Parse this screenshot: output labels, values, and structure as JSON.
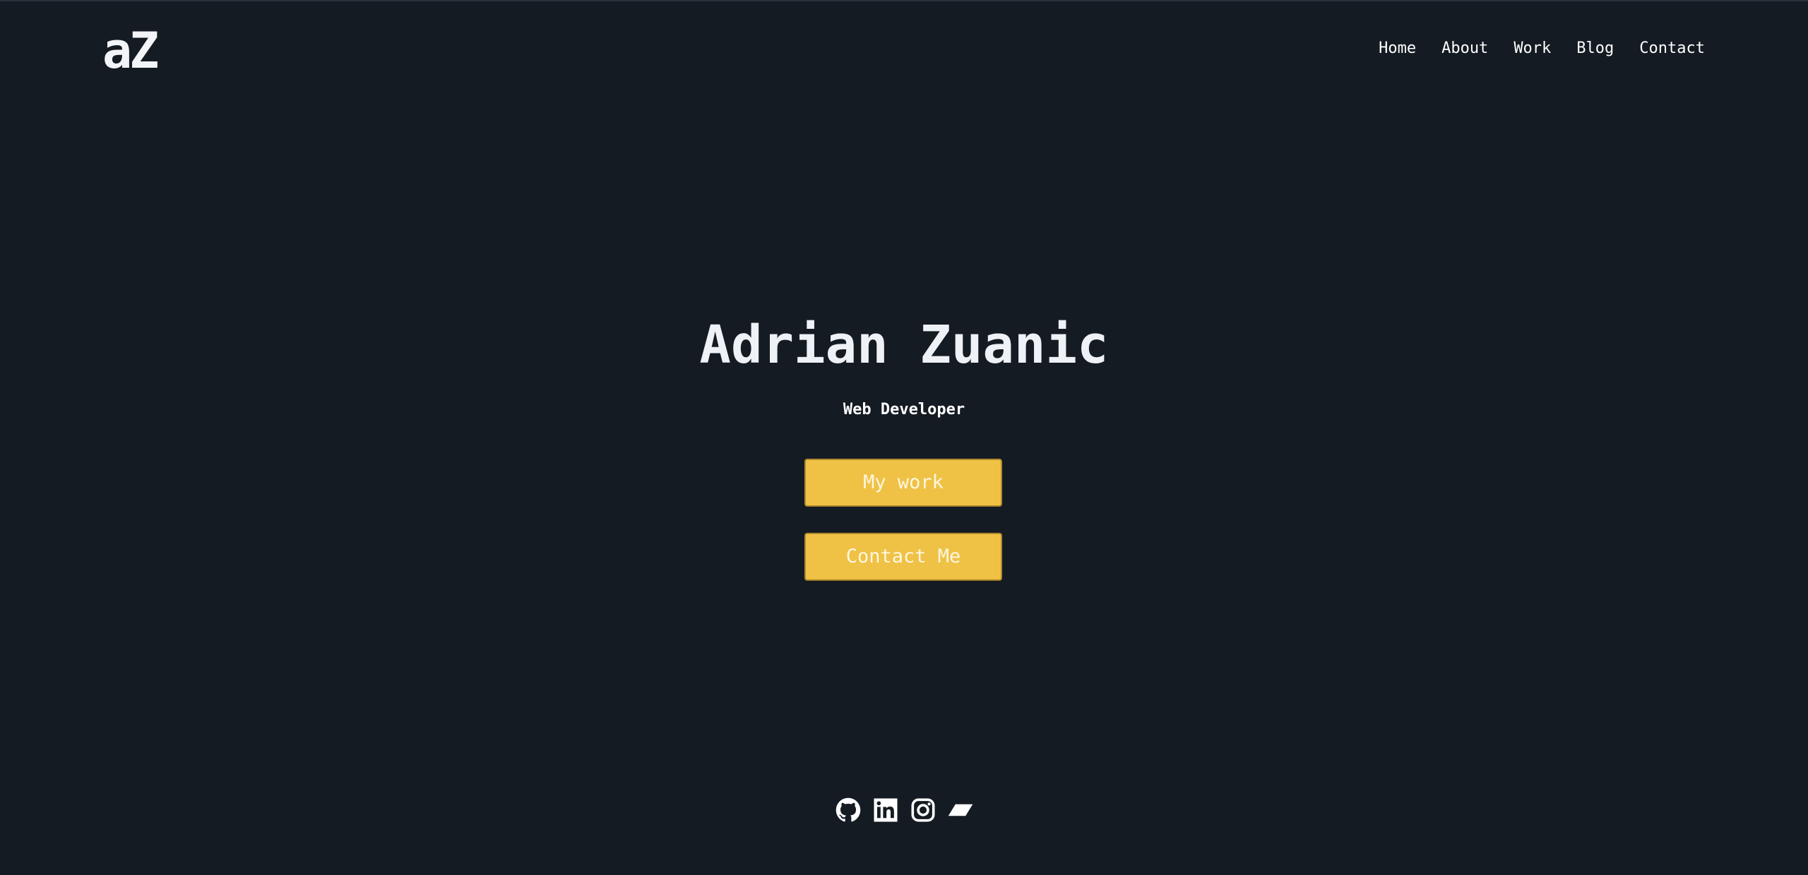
{
  "header": {
    "logo": "aZ",
    "nav": [
      {
        "label": "Home"
      },
      {
        "label": "About"
      },
      {
        "label": "Work"
      },
      {
        "label": "Blog"
      },
      {
        "label": "Contact"
      }
    ]
  },
  "hero": {
    "title": "Adrian Zuanic",
    "subtitle": "Web Developer",
    "buttons": {
      "work": "My work",
      "contact": "Contact Me"
    }
  },
  "social": [
    {
      "icon": "github-icon"
    },
    {
      "icon": "linkedin-icon"
    },
    {
      "icon": "instagram-icon"
    },
    {
      "icon": "codepen-icon"
    }
  ],
  "colors": {
    "background": "#141b22",
    "accent": "#efc246",
    "text": "#ffffff"
  }
}
